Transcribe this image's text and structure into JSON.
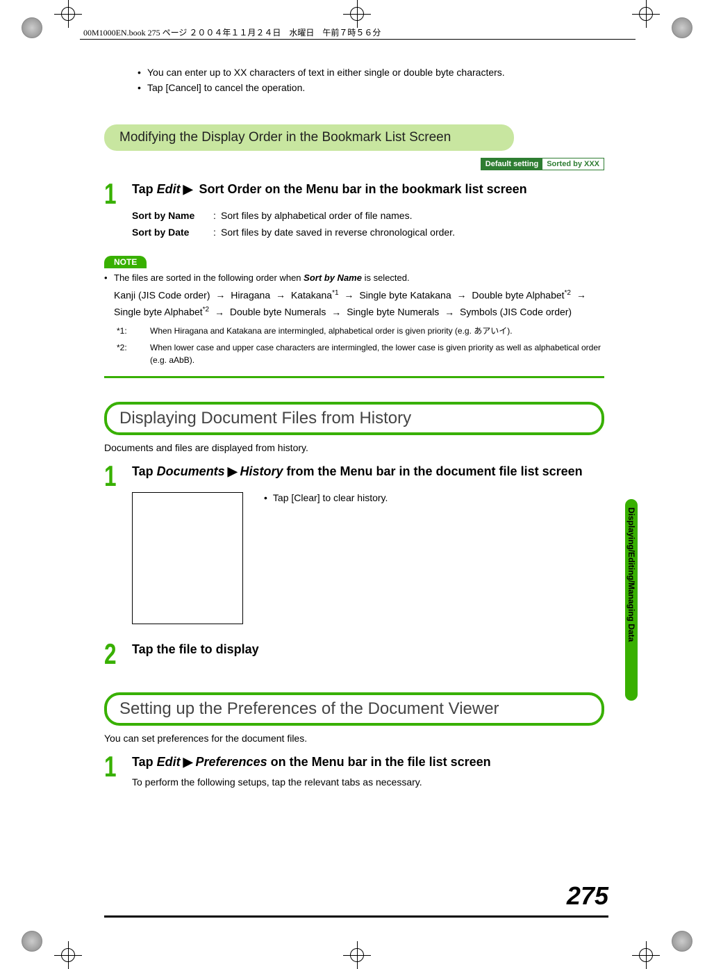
{
  "header_line": "00M1000EN.book  275 ページ  ２００４年１１月２４日　水曜日　午前７時５６分",
  "bullets_top": [
    "You can enter up to XX characters of text in either single or double byte characters.",
    "Tap [Cancel] to cancel the operation."
  ],
  "section1": {
    "title": "Modifying the Display Order in the Bookmark List Screen",
    "badge_left": "Default setting",
    "badge_right": "Sorted by XXX",
    "step_num": "1",
    "step_title_a": "Tap ",
    "step_title_em": "Edit",
    "step_title_b": " Sort Order on the Menu bar in the bookmark list screen",
    "sort_name_key": "Sort by Name",
    "sort_name_val": "Sort files by alphabetical order of file names.",
    "sort_date_key": "Sort by Date",
    "sort_date_val": "Sort files by date saved in reverse chronological order."
  },
  "note": {
    "label": "NOTE",
    "lead_a": "The files are sorted in the following order when ",
    "lead_em": "Sort by Name",
    "lead_b": " is selected.",
    "seq_parts": [
      "Kanji (JIS Code order)",
      "Hiragana",
      "Katakana",
      "*1",
      "Single byte Katakana",
      "Double byte Alphabet",
      "*2",
      "Single byte Alphabet",
      "*2",
      "Double byte Numerals",
      "Single byte Numerals",
      "Symbols (JIS Code order)"
    ],
    "fn1_key": "*1:",
    "fn1_val_a": "When Hiragana and Katakana are intermingled, alphabetical order is given priority (e.g. ",
    "fn1_jp": "あアいイ",
    "fn1_val_b": ").",
    "fn2_key": "*2:",
    "fn2_val": "When lower case and upper case characters are intermingled, the lower case is given priority as well as alphabetical order (e.g. aAbB)."
  },
  "section2": {
    "title": "Displaying Document Files from History",
    "intro": "Documents and files are displayed from history.",
    "step_num": "1",
    "step_title_a": "Tap ",
    "step_title_em1": "Documents",
    "step_title_em2": "History",
    "step_title_b": " from the Menu bar in the document file list screen",
    "history_note": "Tap [Clear] to clear history.",
    "step2_num": "2",
    "step2_title": "Tap the file to display"
  },
  "section3": {
    "title": "Setting up the Preferences of the Document Viewer",
    "intro": "You can set preferences for the document files.",
    "step_num": "1",
    "step_title_a": "Tap ",
    "step_title_em1": "Edit",
    "step_title_em2": "Preferences",
    "step_title_b": " on the Menu bar in the file list screen",
    "desc": "To perform the following setups, tap the relevant tabs as necessary."
  },
  "side_label": "Displaying/Editing/Managing Data",
  "page_number": "275",
  "arrow": "▶",
  "seq_arrow": "→"
}
